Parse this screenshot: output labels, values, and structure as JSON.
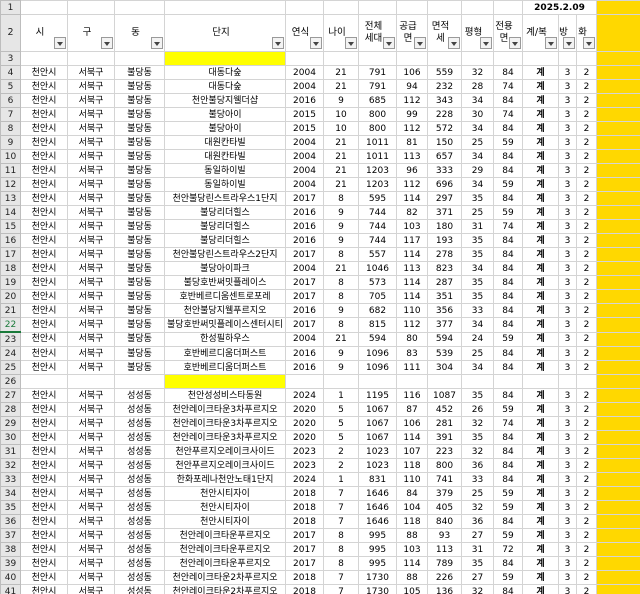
{
  "sheet": {
    "date": "2025.2.09",
    "row_numbers": [
      "1",
      "2",
      "3",
      "4",
      "5",
      "6",
      "7",
      "8",
      "9",
      "10",
      "11",
      "12",
      "13",
      "14",
      "15",
      "16",
      "17",
      "18",
      "19",
      "20",
      "21",
      "22",
      "23",
      "24",
      "25",
      "26",
      "27",
      "28",
      "29",
      "30",
      "31",
      "32",
      "33",
      "34",
      "35",
      "36",
      "37",
      "38",
      "39",
      "40",
      "41"
    ],
    "headers": [
      "시",
      "구",
      "동",
      "단지",
      "연식",
      "나이",
      "전체\n세대",
      "공급\n면",
      "면적\n세",
      "평형",
      "전용\n면",
      "계/복",
      "방",
      "화"
    ],
    "group1": [
      [
        "천안시",
        "서북구",
        "불당동",
        "대동다숲",
        "2004",
        "21",
        "791",
        "106",
        "559",
        "32",
        "84",
        "계",
        "3",
        "2"
      ],
      [
        "천안시",
        "서북구",
        "불당동",
        "대동다숲",
        "2004",
        "21",
        "791",
        "94",
        "232",
        "28",
        "74",
        "계",
        "3",
        "2"
      ],
      [
        "천안시",
        "서북구",
        "불당동",
        "천안불당지웰더샵",
        "2016",
        "9",
        "685",
        "112",
        "343",
        "34",
        "84",
        "계",
        "3",
        "2"
      ],
      [
        "천안시",
        "서북구",
        "불당동",
        "불당아이",
        "2015",
        "10",
        "800",
        "99",
        "228",
        "30",
        "74",
        "계",
        "3",
        "2"
      ],
      [
        "천안시",
        "서북구",
        "불당동",
        "불당아이",
        "2015",
        "10",
        "800",
        "112",
        "572",
        "34",
        "84",
        "계",
        "3",
        "2"
      ],
      [
        "천안시",
        "서북구",
        "불당동",
        "대원칸타빌",
        "2004",
        "21",
        "1011",
        "81",
        "150",
        "25",
        "59",
        "계",
        "3",
        "2"
      ],
      [
        "천안시",
        "서북구",
        "불당동",
        "대원칸타빌",
        "2004",
        "21",
        "1011",
        "113",
        "657",
        "34",
        "84",
        "계",
        "3",
        "2"
      ],
      [
        "천안시",
        "서북구",
        "불당동",
        "동일하이빌",
        "2004",
        "21",
        "1203",
        "96",
        "333",
        "29",
        "84",
        "계",
        "3",
        "2"
      ],
      [
        "천안시",
        "서북구",
        "불당동",
        "동일하이빌",
        "2004",
        "21",
        "1203",
        "112",
        "696",
        "34",
        "59",
        "계",
        "3",
        "2"
      ],
      [
        "천안시",
        "서북구",
        "불당동",
        "천안불당린스트라우스1단지",
        "2017",
        "8",
        "595",
        "114",
        "297",
        "35",
        "84",
        "계",
        "3",
        "2"
      ],
      [
        "천안시",
        "서북구",
        "불당동",
        "불당리더힐스",
        "2016",
        "9",
        "744",
        "82",
        "371",
        "25",
        "59",
        "계",
        "3",
        "2"
      ],
      [
        "천안시",
        "서북구",
        "불당동",
        "불당리더힐스",
        "2016",
        "9",
        "744",
        "103",
        "180",
        "31",
        "74",
        "계",
        "3",
        "2"
      ],
      [
        "천안시",
        "서북구",
        "불당동",
        "불당리더힐스",
        "2016",
        "9",
        "744",
        "117",
        "193",
        "35",
        "84",
        "계",
        "3",
        "2"
      ],
      [
        "천안시",
        "서북구",
        "불당동",
        "천안불당린스트라우스2단지",
        "2017",
        "8",
        "557",
        "114",
        "278",
        "35",
        "84",
        "계",
        "3",
        "2"
      ],
      [
        "천안시",
        "서북구",
        "불당동",
        "불당아이파크",
        "2004",
        "21",
        "1046",
        "113",
        "823",
        "34",
        "84",
        "계",
        "3",
        "2"
      ],
      [
        "천안시",
        "서북구",
        "불당동",
        "불당호반써밋플레이스",
        "2017",
        "8",
        "573",
        "114",
        "287",
        "35",
        "84",
        "계",
        "3",
        "2"
      ],
      [
        "천안시",
        "서북구",
        "불당동",
        "호반베르디움센트로포레",
        "2017",
        "8",
        "705",
        "114",
        "351",
        "35",
        "84",
        "계",
        "3",
        "2"
      ],
      [
        "천안시",
        "서북구",
        "불당동",
        "천안불당지웰푸르지오",
        "2016",
        "9",
        "682",
        "110",
        "356",
        "33",
        "84",
        "계",
        "3",
        "2"
      ],
      [
        "천안시",
        "서북구",
        "불당동",
        "불당호반써밋플레이스센터시티",
        "2017",
        "8",
        "815",
        "112",
        "377",
        "34",
        "84",
        "계",
        "3",
        "2"
      ],
      [
        "천안시",
        "서북구",
        "불당동",
        "한성필하우스",
        "2004",
        "21",
        "594",
        "80",
        "594",
        "24",
        "59",
        "계",
        "3",
        "2"
      ],
      [
        "천안시",
        "서북구",
        "불당동",
        "호반베르디움더퍼스트",
        "2016",
        "9",
        "1096",
        "83",
        "539",
        "25",
        "84",
        "계",
        "3",
        "2"
      ],
      [
        "천안시",
        "서북구",
        "불당동",
        "호반베르디움더퍼스트",
        "2016",
        "9",
        "1096",
        "111",
        "304",
        "34",
        "84",
        "계",
        "3",
        "2"
      ]
    ],
    "group2": [
      [
        "천안시",
        "서북구",
        "성성동",
        "천안성성비스타동원",
        "2024",
        "1",
        "1195",
        "116",
        "1087",
        "35",
        "84",
        "계",
        "3",
        "2"
      ],
      [
        "천안시",
        "서북구",
        "성성동",
        "천안레이크타운3차푸르지오",
        "2020",
        "5",
        "1067",
        "87",
        "452",
        "26",
        "59",
        "계",
        "3",
        "2"
      ],
      [
        "천안시",
        "서북구",
        "성성동",
        "천안레이크타운3차푸르지오",
        "2020",
        "5",
        "1067",
        "106",
        "281",
        "32",
        "74",
        "계",
        "3",
        "2"
      ],
      [
        "천안시",
        "서북구",
        "성성동",
        "천안레이크타운3차푸르지오",
        "2020",
        "5",
        "1067",
        "114",
        "391",
        "35",
        "84",
        "계",
        "3",
        "2"
      ],
      [
        "천안시",
        "서북구",
        "성성동",
        "천안푸르지오레이크사이드",
        "2023",
        "2",
        "1023",
        "107",
        "223",
        "32",
        "84",
        "계",
        "3",
        "2"
      ],
      [
        "천안시",
        "서북구",
        "성성동",
        "천안푸르지오레이크사이드",
        "2023",
        "2",
        "1023",
        "118",
        "800",
        "36",
        "84",
        "계",
        "3",
        "2"
      ],
      [
        "천안시",
        "서북구",
        "성성동",
        "한화포레나천안노태1단지",
        "2024",
        "1",
        "831",
        "110",
        "741",
        "33",
        "84",
        "계",
        "3",
        "2"
      ],
      [
        "천안시",
        "서북구",
        "성성동",
        "천안시티자이",
        "2018",
        "7",
        "1646",
        "84",
        "379",
        "25",
        "59",
        "계",
        "3",
        "2"
      ],
      [
        "천안시",
        "서북구",
        "성성동",
        "천안시티자이",
        "2018",
        "7",
        "1646",
        "104",
        "405",
        "32",
        "59",
        "계",
        "3",
        "2"
      ],
      [
        "천안시",
        "서북구",
        "성성동",
        "천안시티자이",
        "2018",
        "7",
        "1646",
        "118",
        "840",
        "36",
        "84",
        "계",
        "3",
        "2"
      ],
      [
        "천안시",
        "서북구",
        "성성동",
        "천안레이크타운푸르지오",
        "2017",
        "8",
        "995",
        "88",
        "93",
        "27",
        "59",
        "계",
        "3",
        "2"
      ],
      [
        "천안시",
        "서북구",
        "성성동",
        "천안레이크타운푸르지오",
        "2017",
        "8",
        "995",
        "103",
        "113",
        "31",
        "72",
        "계",
        "3",
        "2"
      ],
      [
        "천안시",
        "서북구",
        "성성동",
        "천안레이크타운푸르지오",
        "2017",
        "8",
        "995",
        "114",
        "789",
        "35",
        "84",
        "계",
        "3",
        "2"
      ],
      [
        "천안시",
        "서북구",
        "성성동",
        "천안레이크타운2차푸르지오",
        "2018",
        "7",
        "1730",
        "88",
        "226",
        "27",
        "59",
        "계",
        "3",
        "2"
      ],
      [
        "천안시",
        "서북구",
        "성성동",
        "천안레이크타운2차푸르지오",
        "2018",
        "7",
        "1730",
        "105",
        "136",
        "32",
        "84",
        "계",
        "3",
        "2"
      ]
    ]
  }
}
